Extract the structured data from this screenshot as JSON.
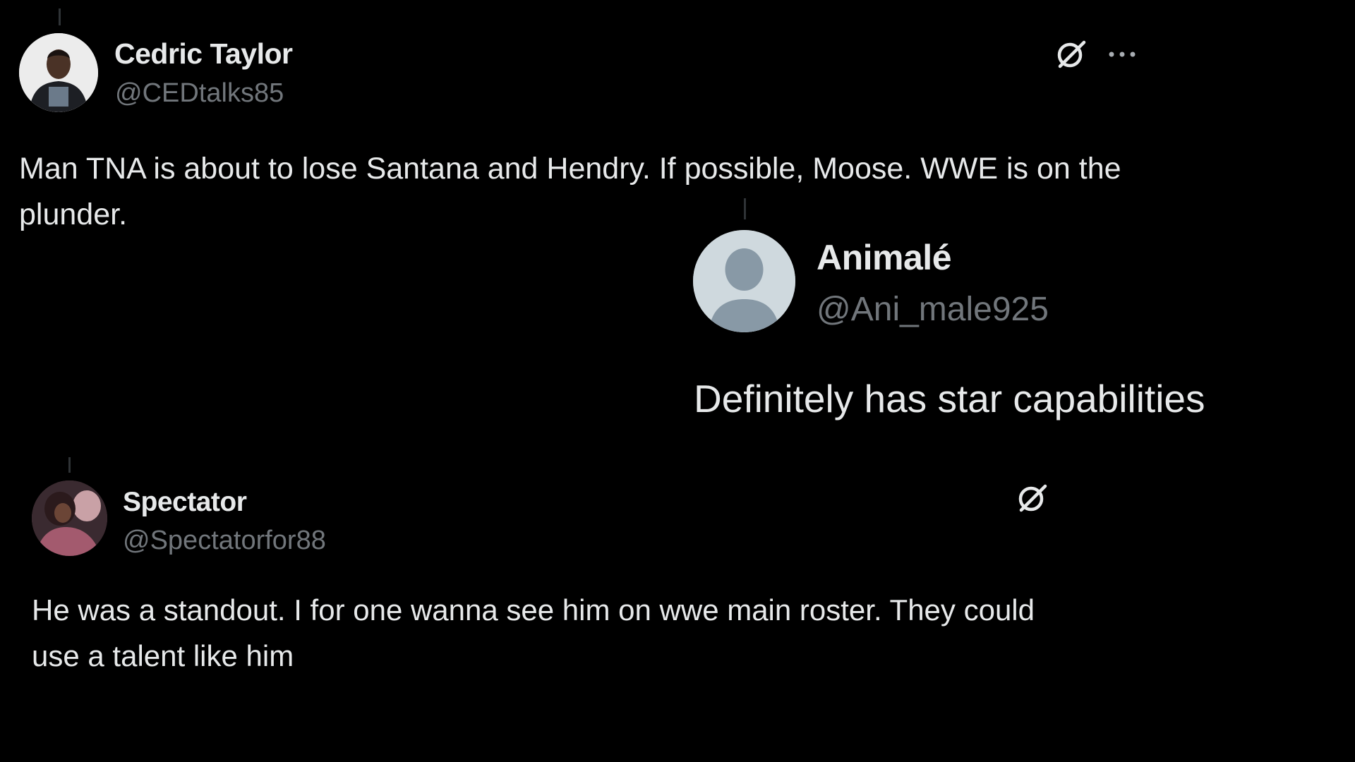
{
  "tweets": [
    {
      "name": "Cedric Taylor",
      "handle": "@CEDtalks85",
      "text": "Man TNA is about to lose Santana and Hendry. If possible, Moose. WWE is on the plunder.",
      "icons": [
        "grok-icon",
        "more-icon"
      ]
    },
    {
      "name": "Animalé",
      "handle": "@Ani_male925",
      "text": "Definitely has star capabilities",
      "icons": [
        "default-avatar-icon"
      ]
    },
    {
      "name": "Spectator",
      "handle": "@Spectatorfor88",
      "text": "He was a standout. I for one wanna see him on wwe main roster. They could use a talent like him",
      "icons": [
        "grok-icon"
      ]
    }
  ],
  "colors": {
    "background": "#000000",
    "primary_text": "#e7e9ea",
    "secondary_text": "#71767b",
    "default_avatar_bg": "#cfd9de",
    "default_avatar_fg": "#8899a6"
  }
}
